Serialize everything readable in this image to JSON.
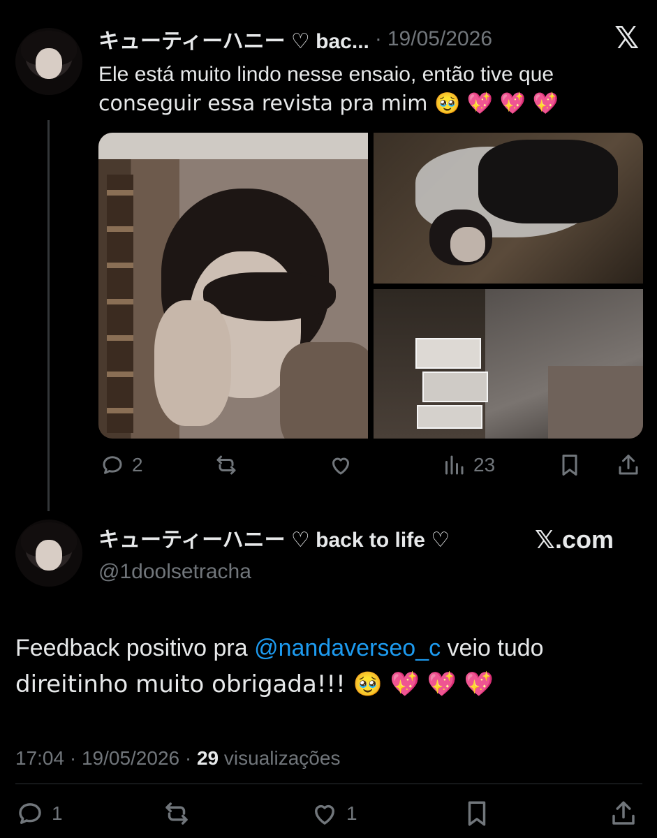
{
  "tweet1": {
    "name": "キューティーハニー ♡ bac...",
    "separator": "·",
    "date": "19/05/2026",
    "text_line1": "Ele está muito lindo nesse ensaio, então tive que",
    "text_line2": "conseguir essa revista pra mim 🥹 💖 💖 💖",
    "actions": {
      "replies": "2",
      "views": "23"
    }
  },
  "tweet2": {
    "name": "キューティーハニー ♡ back to life ♡",
    "handle": "@1doolsetracha",
    "brand": "𝕏.com",
    "text_before": "Feedback positivo pra ",
    "mention": "@nandaverseo_c",
    "text_after": " veio tudo",
    "text_line2": "direitinho muito obrigada!!! 🥹 💖 💖 💖",
    "meta_time": "17:04 · 19/05/2026 · ",
    "meta_views": "29",
    "meta_views_label": " visualizações",
    "actions": {
      "replies": "1",
      "likes": "1"
    }
  },
  "icons": {
    "x_logo": "𝕏"
  }
}
